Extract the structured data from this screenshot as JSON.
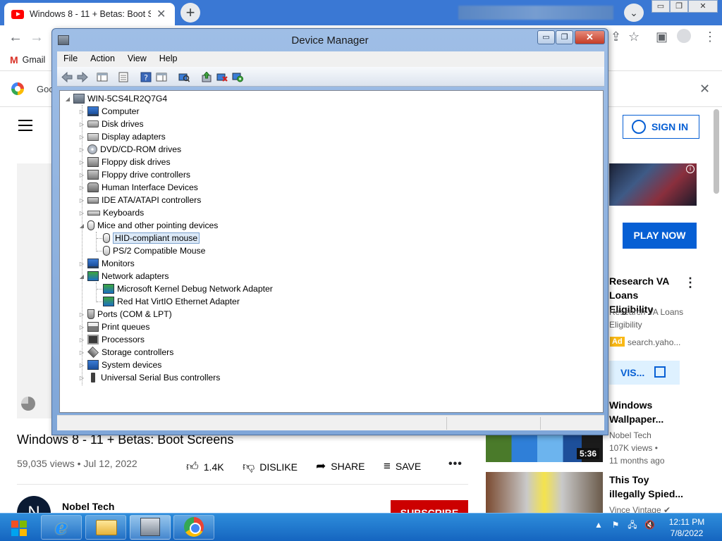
{
  "browser": {
    "tab_title": "Windows 8 - 11 + Betas: Boot Sc",
    "tab_close": "✕",
    "new_tab": "+",
    "tab_search": "⌄",
    "window_controls": [
      "▭",
      "❐",
      "✕"
    ],
    "bookmarks": [
      {
        "label": "Gmail"
      }
    ],
    "infobar_text": "Goo",
    "infobar_close": "✕",
    "back": "←",
    "forward": "→",
    "toolbar_icons": [
      "share-icon",
      "star-icon",
      "sidebar-icon",
      "profile-icon",
      "menu-icon"
    ]
  },
  "youtube": {
    "signin_label": "SIGN IN",
    "video_title": "Windows 8 - 11 + Betas: Boot Screens",
    "meta": "59,035 views • Jul 12, 2022",
    "actions": {
      "like": "1.4K",
      "dislike": "DISLIKE",
      "share": "SHARE",
      "save": "SAVE",
      "more": "•••"
    },
    "channel": {
      "initial": "N",
      "name": "Nobel Tech",
      "subscribe": "SUBSCRIBE"
    },
    "ad": {
      "play_now": "PLAY NOW",
      "title": "Research VA Loans Eligibility",
      "subtitle": "Research VA Loans Eligibility",
      "badge": "Ad",
      "domain": "search.yaho...",
      "visit": "VIS...",
      "info": "i",
      "kebab": "⋮"
    },
    "recommendations": [
      {
        "title": "Windows Wallpaper...",
        "channel": "Nobel Tech",
        "views": "107K views •",
        "age": "11 months ago",
        "duration": "5:36"
      },
      {
        "title": "This Toy illegally Spied...",
        "channel": "Vince Vintage ✔"
      }
    ]
  },
  "device_manager": {
    "title": "Device Manager",
    "window_buttons": {
      "minimize": "▭",
      "maximize": "❐",
      "close": "✕"
    },
    "menu": [
      "File",
      "Action",
      "View",
      "Help"
    ],
    "tree": {
      "root": "WIN-5CS4LR2Q7G4",
      "categories": [
        {
          "label": "Computer",
          "icon": "computer-icon",
          "expanded": false
        },
        {
          "label": "Disk drives",
          "icon": "disk-drive-icon",
          "expanded": false
        },
        {
          "label": "Display adapters",
          "icon": "display-adapter-icon",
          "expanded": false
        },
        {
          "label": "DVD/CD-ROM drives",
          "icon": "cd-drive-icon",
          "expanded": false
        },
        {
          "label": "Floppy disk drives",
          "icon": "floppy-icon",
          "expanded": false
        },
        {
          "label": "Floppy drive controllers",
          "icon": "floppy-controller-icon",
          "expanded": false
        },
        {
          "label": "Human Interface Devices",
          "icon": "hid-icon",
          "expanded": false
        },
        {
          "label": "IDE ATA/ATAPI controllers",
          "icon": "ide-controller-icon",
          "expanded": false
        },
        {
          "label": "Keyboards",
          "icon": "keyboard-icon",
          "expanded": false
        },
        {
          "label": "Mice and other pointing devices",
          "icon": "mouse-icon",
          "expanded": true,
          "children": [
            {
              "label": "HID-compliant mouse",
              "selected": true
            },
            {
              "label": "PS/2 Compatible Mouse",
              "selected": false
            }
          ]
        },
        {
          "label": "Monitors",
          "icon": "monitor-icon",
          "expanded": false
        },
        {
          "label": "Network adapters",
          "icon": "network-adapter-icon",
          "expanded": true,
          "children": [
            {
              "label": "Microsoft Kernel Debug Network Adapter",
              "selected": false
            },
            {
              "label": "Red Hat VirtIO Ethernet Adapter",
              "selected": false
            }
          ]
        },
        {
          "label": "Ports (COM & LPT)",
          "icon": "port-icon",
          "expanded": false
        },
        {
          "label": "Print queues",
          "icon": "printer-icon",
          "expanded": false
        },
        {
          "label": "Processors",
          "icon": "processor-icon",
          "expanded": false
        },
        {
          "label": "Storage controllers",
          "icon": "storage-controller-icon",
          "expanded": false
        },
        {
          "label": "System devices",
          "icon": "system-device-icon",
          "expanded": false
        },
        {
          "label": "Universal Serial Bus controllers",
          "icon": "usb-icon",
          "expanded": false
        }
      ]
    },
    "toolbar": [
      "back-icon",
      "forward-icon",
      "show-hide-console-tree-icon",
      "properties-icon",
      "help-icon",
      "action-pane-icon",
      "scan-hardware-icon",
      "update-driver-icon",
      "uninstall-icon",
      "enable-device-icon"
    ]
  },
  "taskbar": {
    "clock_time": "12:11 PM",
    "clock_date": "7/8/2022",
    "tray": {
      "show_hidden": "▲",
      "flag": "⚑",
      "network": "🖧",
      "volume": "🔇"
    },
    "pinned": [
      "internet-explorer-icon",
      "file-explorer-icon",
      "device-manager-icon",
      "chrome-icon"
    ]
  }
}
